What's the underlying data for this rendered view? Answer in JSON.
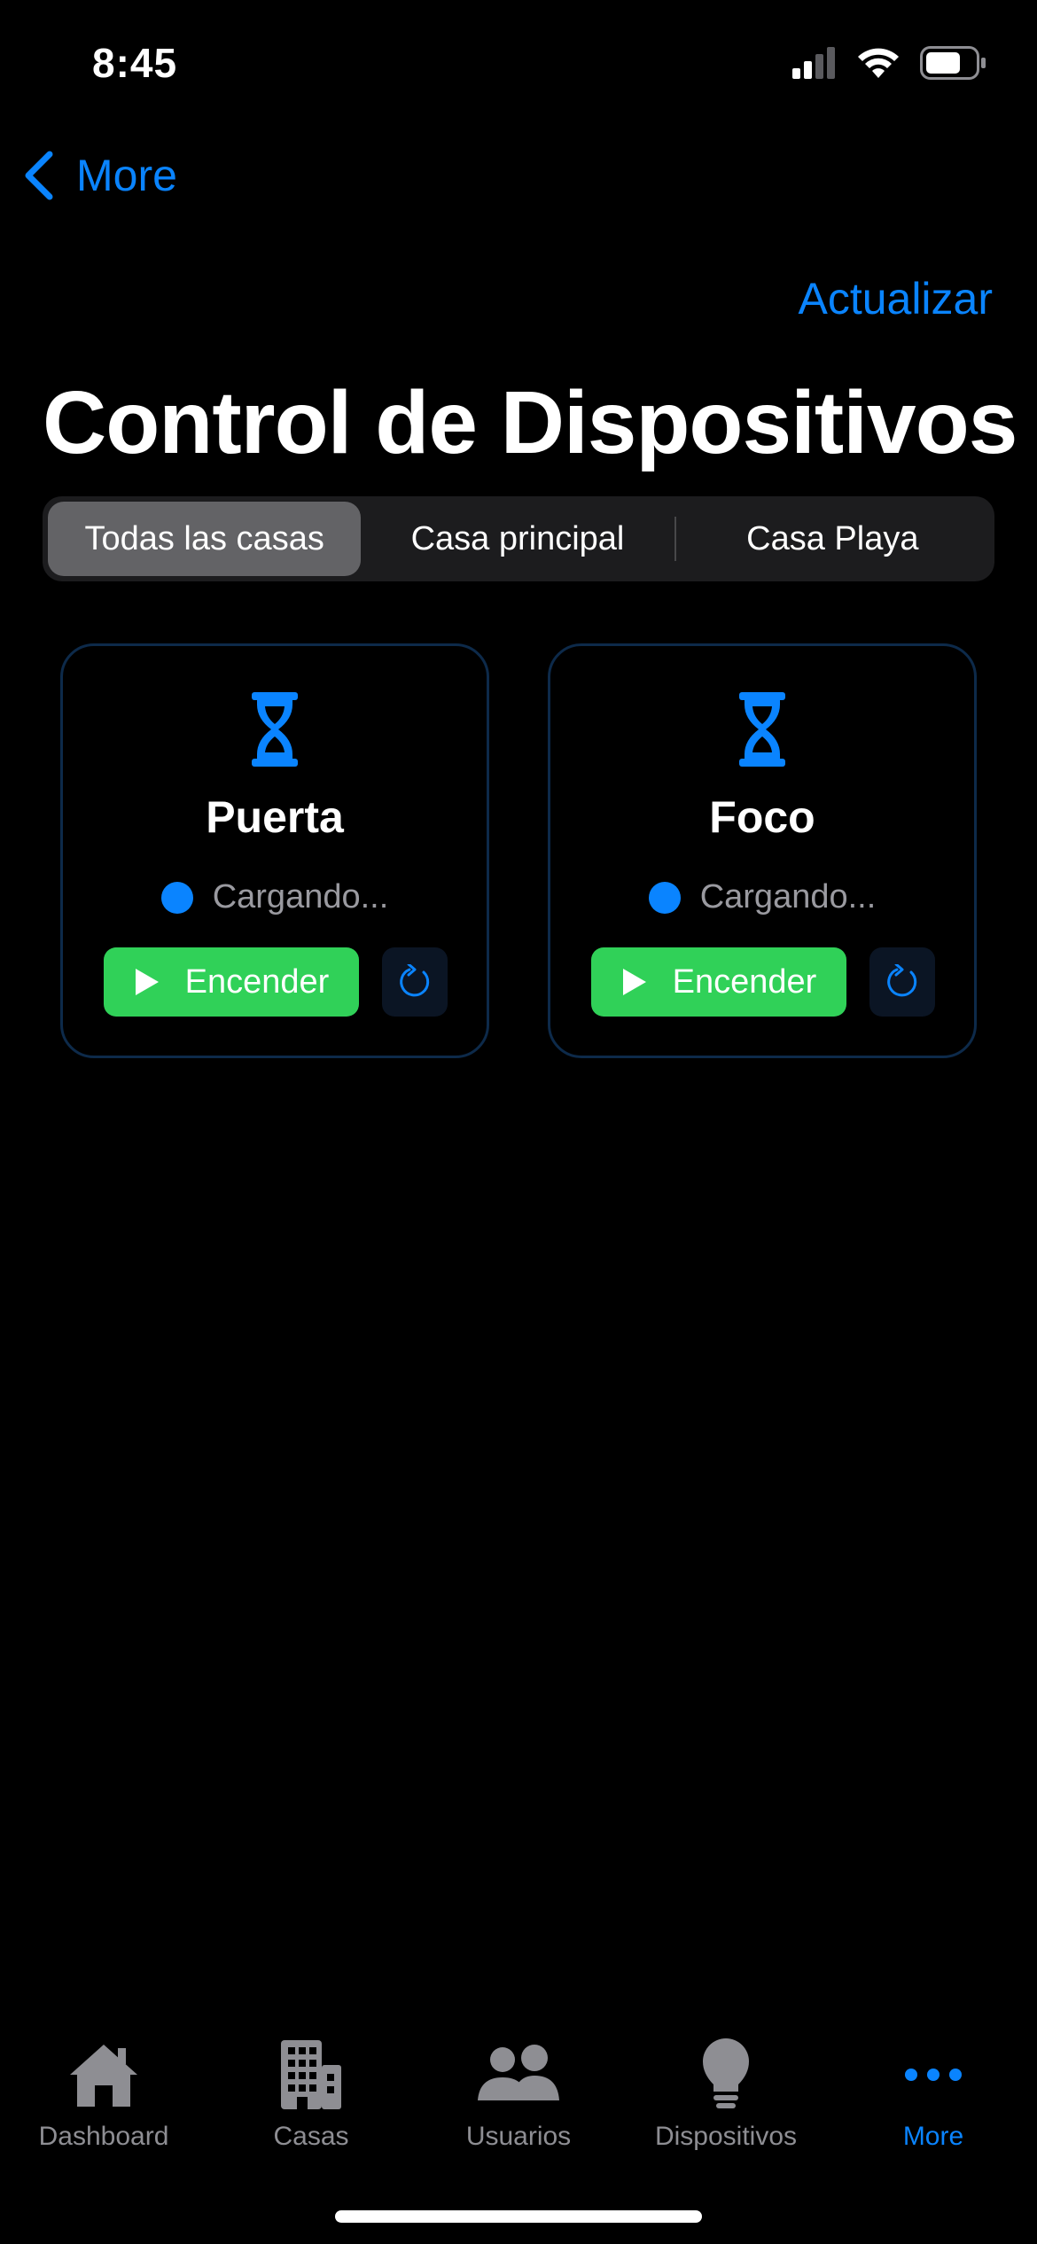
{
  "status_bar": {
    "time": "8:45"
  },
  "nav": {
    "back_label": "More",
    "refresh_label": "Actualizar"
  },
  "page": {
    "title": "Control de Dispositivos"
  },
  "filters": {
    "selected": "Todas las casas",
    "options": [
      "Todas las casas",
      "Casa principal",
      "Casa Playa"
    ]
  },
  "devices": [
    {
      "name": "Puerta",
      "status": "Cargando...",
      "action_label": "Encender",
      "icon": "hourglass-icon"
    },
    {
      "name": "Foco",
      "status": "Cargando...",
      "action_label": "Encender",
      "icon": "hourglass-icon"
    }
  ],
  "tab_bar": {
    "items": [
      {
        "label": "Dashboard",
        "icon": "house-icon"
      },
      {
        "label": "Casas",
        "icon": "building-icon"
      },
      {
        "label": "Usuarios",
        "icon": "users-icon"
      },
      {
        "label": "Dispositivos",
        "icon": "lightbulb-icon"
      },
      {
        "label": "More",
        "icon": "more-icon"
      }
    ],
    "active": "More"
  },
  "colors": {
    "accent": "#0a84ff",
    "success": "#30d158",
    "background": "#000000",
    "segment_bg": "#1c1c1e",
    "segment_active": "#636366",
    "inactive": "#8e8e93"
  }
}
